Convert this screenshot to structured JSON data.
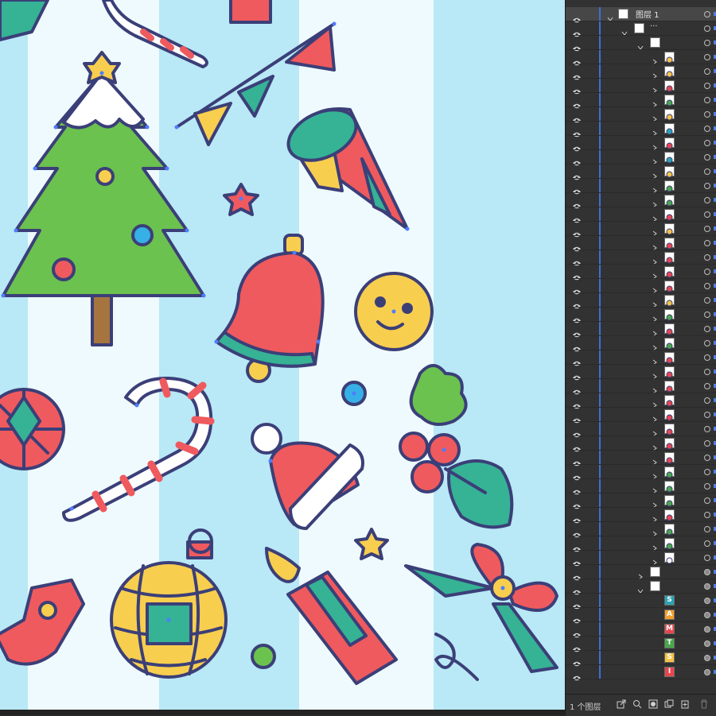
{
  "layers_panel": {
    "top_layer_name": "图层 1",
    "sublayer_name": "...",
    "footer_count": "1 个图层",
    "row_count": 47,
    "item_colors": [
      "#f6c344",
      "#f6c344",
      "#e8464e",
      "#49a84a",
      "#f6c344",
      "#2aa4b4",
      "#e8464e",
      "#2aa4b4",
      "#f6c344",
      "#49a84a",
      "#49a84a",
      "#e8464e",
      "#f6c344",
      "#e8464e",
      "#e8464e",
      "#e8464e",
      "#e8464e",
      "#f6c344",
      "#49a84a",
      "#e8464e",
      "#49a84a",
      "#e8464e",
      "#e8464e",
      "#e8464e",
      "#e8464e",
      "#e8464e",
      "#e8464e",
      "#e8464e",
      "#e8464e",
      "#49a84a",
      "#49a84a",
      "#49a84a",
      "#e8464e",
      "#49a84a",
      "#49a84a",
      "#ffffff"
    ],
    "letters": [
      "S",
      "A",
      "M",
      "T",
      "S",
      "I"
    ],
    "letter_colors": [
      "#2aa4b4",
      "#f6a12c",
      "#e8464e",
      "#49a84a",
      "#f6c344",
      "#e8464e"
    ]
  },
  "colors": {
    "stripe_light": "#eefafd",
    "stripe_blue": "#b9e8f6",
    "outline": "#3b3f78",
    "anchor": "#4d7dff",
    "red": "#ef5a5e",
    "green": "#6bc24f",
    "teal": "#36b295",
    "yellow": "#f8ce4f",
    "panel_bg": "#323232",
    "selection_bar": "#3f6fd6"
  },
  "canvas_objects": [
    "christmas-tree",
    "candy-cane",
    "bunting-flags",
    "party-cone",
    "star",
    "bell",
    "smiley-face",
    "holly",
    "santa-hat",
    "ornament-ball",
    "candle",
    "bow-ribbon",
    "stocking",
    "gift-box"
  ]
}
